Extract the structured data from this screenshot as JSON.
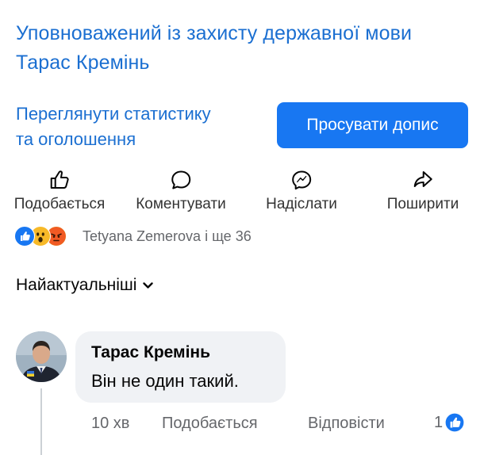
{
  "page": {
    "name_line1": "Уповноважений із захисту державної мови",
    "name_line2": "Тарас Кремінь"
  },
  "insights": {
    "link_line1": "Переглянути статистику",
    "link_line2": "та оголошення",
    "promote_label": "Просувати допис"
  },
  "actions": {
    "like_label": "Подобається",
    "comment_label": "Коментувати",
    "send_label": "Надіслати",
    "share_label": "Поширити"
  },
  "reactions": {
    "summary": "Tetyana Zemerova і ще 36",
    "icons": [
      "like-reaction-icon",
      "wow-reaction-icon",
      "angry-reaction-icon"
    ]
  },
  "comments_sort": {
    "label": "Найактуальніші",
    "icon": "chevron-down-icon"
  },
  "comment": {
    "author": "Тарас Кремінь",
    "text": "Він не один такий.",
    "time": "10 хв",
    "like_label": "Подобається",
    "reply_label": "Відповісти",
    "like_count": "1"
  },
  "colors": {
    "link": "#1b6fd1",
    "brand_blue": "#1877f2",
    "bubble_bg": "#f0f2f5",
    "secondary_text": "#65676b"
  }
}
